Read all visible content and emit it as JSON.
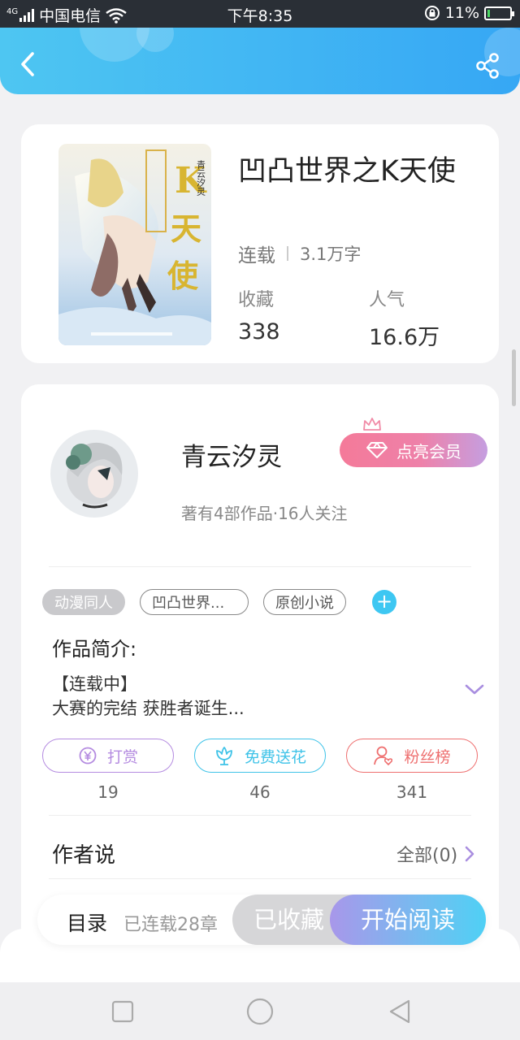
{
  "status_bar": {
    "network": "4G",
    "carrier": "中国电信",
    "time": "下午8:35",
    "battery_percent": "11%",
    "battery_level": 0.11
  },
  "header": {
    "back_icon": "chevron-left-icon",
    "share_icon": "share-icon"
  },
  "book": {
    "cover_title_text": "K天使",
    "cover_author_text": "青云汐灵",
    "title": "凹凸世界之K天使",
    "status": "连载",
    "word_count": "3.1万字",
    "stats": [
      {
        "label": "收藏",
        "value": "338"
      },
      {
        "label": "人气",
        "value": "16.6万"
      }
    ]
  },
  "author": {
    "name": "青云汐灵",
    "subtitle": "著有4部作品·16人关注",
    "vip_button": "点亮会员"
  },
  "tags": [
    {
      "label": "动漫同人",
      "style": "filled"
    },
    {
      "label": "凹凸世界...",
      "style": "outline"
    },
    {
      "label": "原创小说",
      "style": "outline"
    }
  ],
  "intro": {
    "title": "作品简介:",
    "status_line": "【连载中】",
    "text": "大赛的完结 获胜者诞生..."
  },
  "actions": [
    {
      "label": "打赏",
      "count": "19",
      "color": "#b48be0",
      "icon": "coin-icon"
    },
    {
      "label": "免费送花",
      "count": "46",
      "color": "#3fc3e8",
      "icon": "flower-icon"
    },
    {
      "label": "粉丝榜",
      "count": "341",
      "color": "#ee6f6f",
      "icon": "fan-user-icon"
    }
  ],
  "author_says": {
    "title": "作者说",
    "link": "全部(0)"
  },
  "reader_bar": {
    "toc": "目录",
    "chapters": "已连载28章",
    "collected": "已收藏",
    "start_reading": "开始阅读"
  },
  "colors": {
    "header_start": "#4ec6f2",
    "header_end": "#36a7f4",
    "accent_purple": "#a98ee0",
    "accent_cyan": "#3ec7f2"
  }
}
